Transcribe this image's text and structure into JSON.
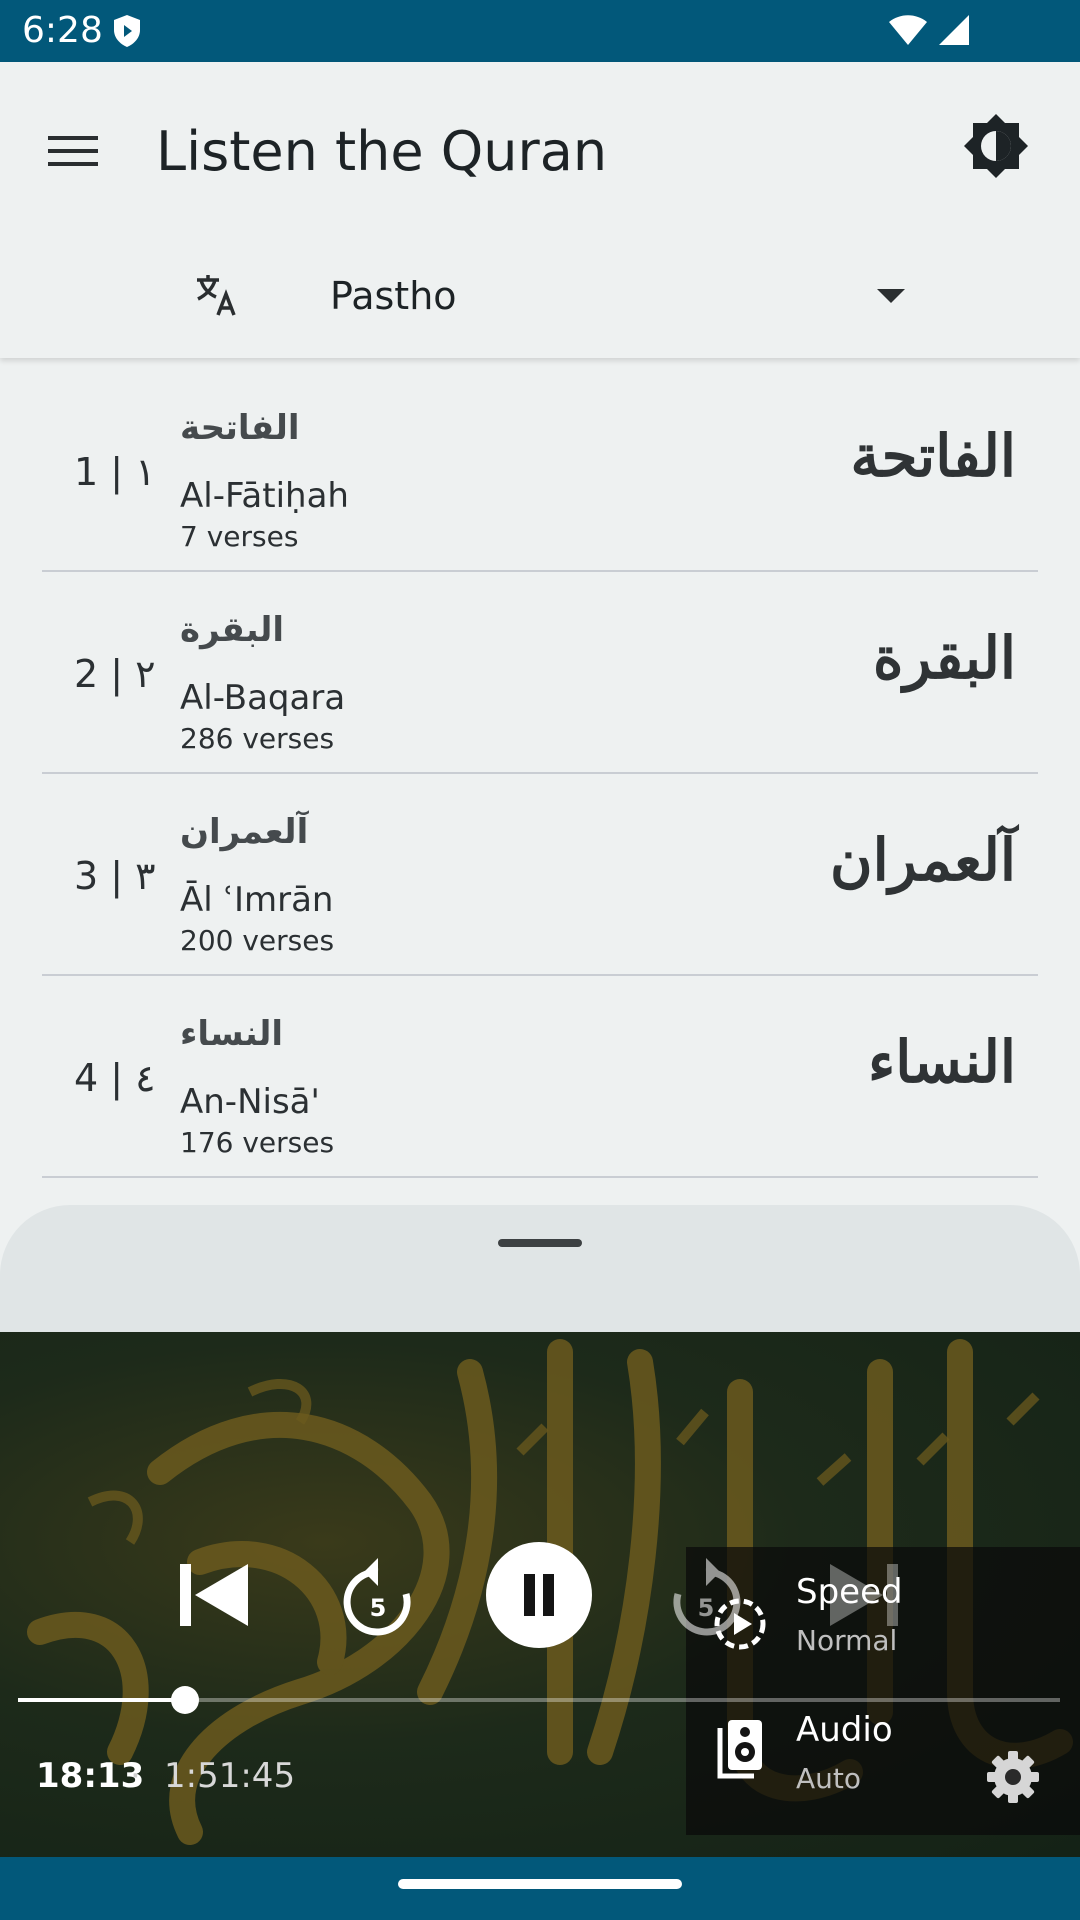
{
  "status_bar": {
    "time": "6:28",
    "icons": [
      "shield-icon",
      "wifi-icon",
      "signal-icon"
    ]
  },
  "app_bar": {
    "title": "Listen the Quran",
    "menu_icon": "menu-icon",
    "theme_icon": "brightness-icon"
  },
  "language": {
    "icon": "translate-icon",
    "selected": "Pastho"
  },
  "surahs": [
    {
      "number": "1 | ١",
      "arabic": "الفاتحة",
      "transliteration": "Al-Fātiḥah",
      "verses": "7 verses"
    },
    {
      "number": "2 | ٢",
      "arabic": "البقرة",
      "transliteration": "Al-Baqara",
      "verses": "286 verses"
    },
    {
      "number": "3 | ٣",
      "arabic": "آلعمران",
      "transliteration": "Āl ʿImrān",
      "verses": "200 verses"
    },
    {
      "number": "4 | ٤",
      "arabic": "النساء",
      "transliteration": "An-Nisā'",
      "verses": "176 verses"
    }
  ],
  "player": {
    "rewind_seconds": "5",
    "forward_seconds": "5",
    "speed_label": "Speed",
    "speed_value": "Normal",
    "audio_label": "Audio",
    "audio_value": "Auto",
    "time_current": "18:13",
    "time_separator": "·",
    "time_total": "1:51:45",
    "progress": 0.16
  },
  "colors": {
    "system_bar": "#02587a",
    "background": "#eef1f1",
    "sheet": "#e0e5e6",
    "player_bg": "#142216",
    "calligraphy": "#6b5a1e"
  }
}
